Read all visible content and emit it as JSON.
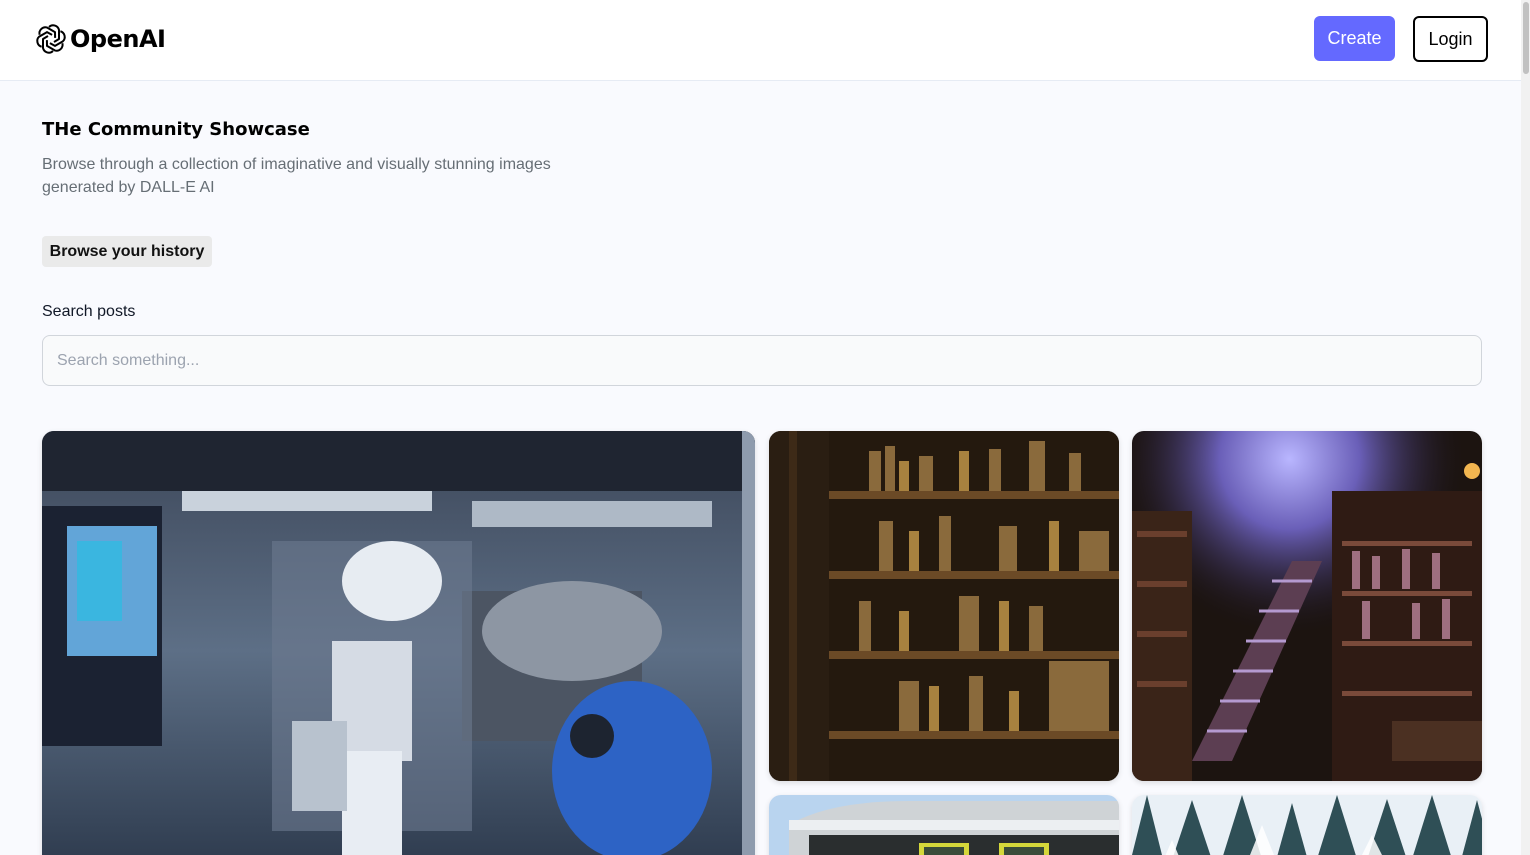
{
  "header": {
    "logo_text": "OpenAI",
    "logo_icon": "openai-logo-icon",
    "create_label": "Create",
    "login_label": "Login"
  },
  "main": {
    "title": "THe Community Showcase",
    "description": "Browse through a collection of imaginative and visually stunning images generated by DALL-E AI",
    "history_button": "Browse your history",
    "search": {
      "label": "Search posts",
      "placeholder": "Search something...",
      "value": ""
    }
  },
  "colors": {
    "accent": "#6469ff",
    "background": "#f9fafe",
    "text_muted": "#666e75"
  }
}
